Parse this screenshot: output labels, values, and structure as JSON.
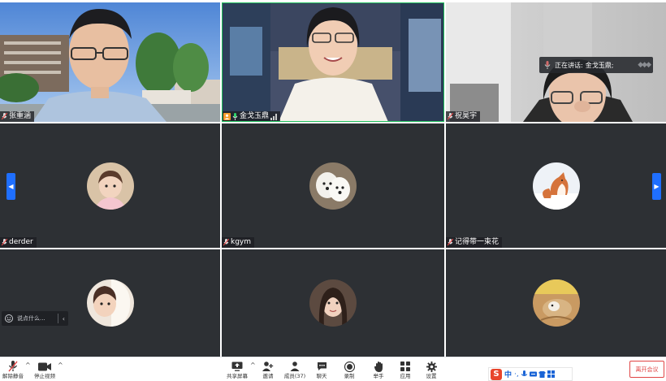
{
  "speaking_indicator": {
    "prefix": "正在讲话:",
    "speaker": "金戈玉鼎;"
  },
  "participants": [
    {
      "name": "张重涵",
      "type": "video"
    },
    {
      "name": "金戈玉鼎",
      "type": "video",
      "active_speaker": true
    },
    {
      "name": "祝昊宇",
      "type": "video"
    },
    {
      "name": "derder",
      "type": "avatar"
    },
    {
      "name": "kgym",
      "type": "avatar"
    },
    {
      "name": "记得带一束花",
      "type": "avatar"
    },
    {
      "name": "",
      "type": "avatar"
    },
    {
      "name": "",
      "type": "avatar"
    },
    {
      "name": "",
      "type": "avatar"
    }
  ],
  "chat": {
    "placeholder": "说点什么..."
  },
  "toolbar": {
    "unmute_label": "解除静音",
    "stop_video_label": "停止视频",
    "share_screen_label": "共享屏幕",
    "invite_label": "邀请",
    "members_label": "成员(37)",
    "chat_label": "聊天",
    "record_label": "录制",
    "raise_hand_label": "举手",
    "apps_label": "应用",
    "settings_label": "设置",
    "leave_label": "离开会议"
  },
  "ime": {
    "mode": "中"
  },
  "colors": {
    "accent": "#1f6fff",
    "leave": "#e04545",
    "speaker_border": "#1fbf5c",
    "tile_bg": "#2d3034"
  }
}
